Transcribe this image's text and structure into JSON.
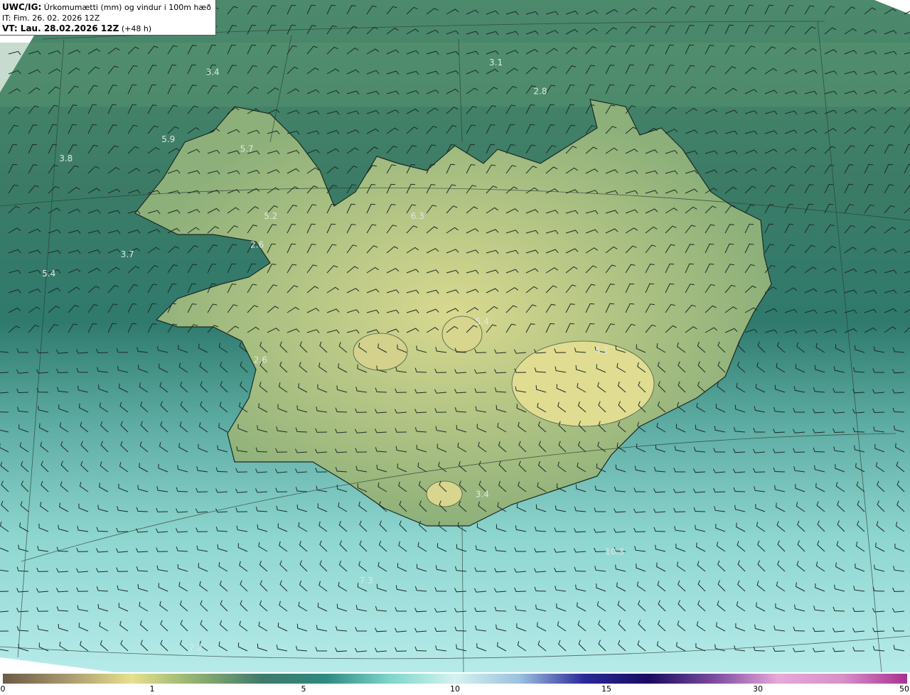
{
  "header": {
    "product": "UWC/IG:",
    "title": "Úrkomumætti (mm) og vindur i 100m hæð",
    "initial_time": "IT: Fim. 26. 02. 2026 12Z",
    "valid_prefix": "VT: Lau. 28.02.2026 12Z",
    "valid_suffix": "(+48 h)"
  },
  "colorbar": {
    "ticks": [
      "0",
      "1",
      "5",
      "10",
      "15",
      "30",
      "50"
    ],
    "colors": [
      "#6b5a45",
      "#a89a6e",
      "#e8e08c",
      "#8fb070",
      "#3f7a6a",
      "#2d8a80",
      "#7fd6cc",
      "#d6f2ef",
      "#9cc0df",
      "#2a2a9a",
      "#1a0a60",
      "#7a4aa0",
      "#e7a8d8",
      "#d890c8",
      "#a83090"
    ]
  },
  "map": {
    "land_color": "#c7cf86",
    "sea_color_north": "#3f7f66",
    "sea_color_south": "#8fd3cc",
    "value_labels": [
      {
        "text": "3.4",
        "lon": -25.3,
        "lat": 67.6
      },
      {
        "text": "3.1",
        "lon": -17.0,
        "lat": 67.7
      },
      {
        "text": "2.8",
        "lon": -15.7,
        "lat": 67.4
      },
      {
        "text": "5.9",
        "lon": -26.6,
        "lat": 66.9
      },
      {
        "text": "5.7",
        "lon": -24.3,
        "lat": 66.8
      },
      {
        "text": "3.8",
        "lon": -29.6,
        "lat": 66.7
      },
      {
        "text": "6.3",
        "lon": -19.3,
        "lat": 66.1
      },
      {
        "text": "5.2",
        "lon": -23.6,
        "lat": 66.1
      },
      {
        "text": "2.6",
        "lon": -24.0,
        "lat": 65.8
      },
      {
        "text": "3.7",
        "lon": -27.8,
        "lat": 65.7
      },
      {
        "text": "5.4",
        "lon": -30.1,
        "lat": 65.5
      },
      {
        "text": "5.4",
        "lon": -17.4,
        "lat": 65.0
      },
      {
        "text": "4.1",
        "lon": -13.9,
        "lat": 64.7
      },
      {
        "text": "2.6",
        "lon": -23.9,
        "lat": 64.6
      },
      {
        "text": "3.4",
        "lon": -17.4,
        "lat": 63.2
      },
      {
        "text": "10.3",
        "lon": -13.6,
        "lat": 62.6
      },
      {
        "text": "7.3",
        "lon": -20.8,
        "lat": 62.3
      },
      {
        "text": "7.2",
        "lon": -25.8,
        "lat": 61.6
      }
    ]
  }
}
